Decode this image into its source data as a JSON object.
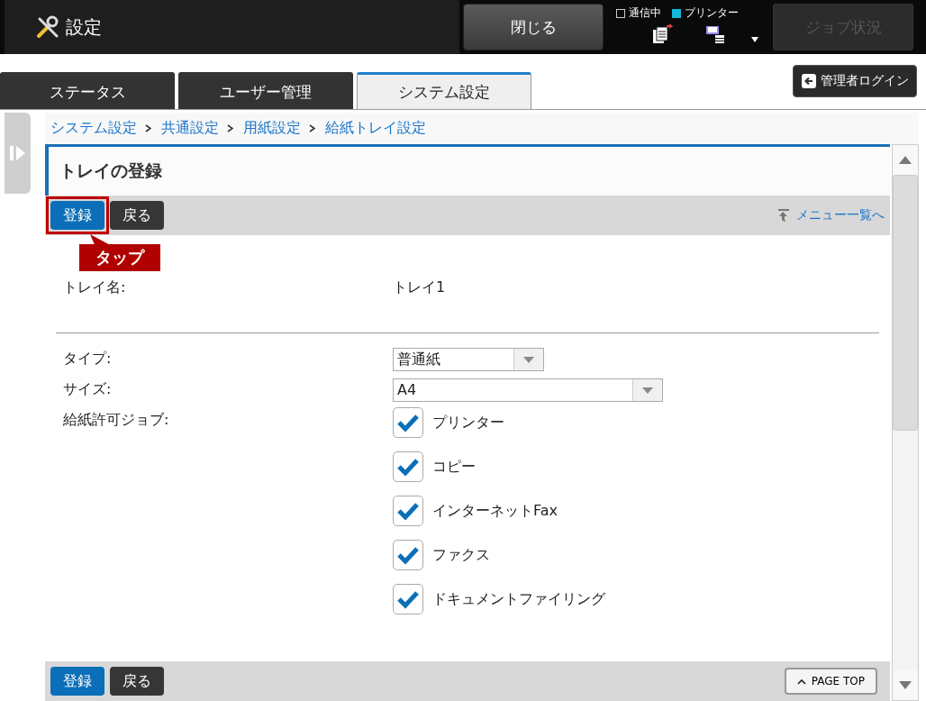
{
  "header": {
    "title": "設定",
    "close_button": "閉じる",
    "indicators": [
      {
        "label": "通信中",
        "on": false
      },
      {
        "label": "プリンター",
        "on": true
      }
    ],
    "job_status_button": {
      "label": "ジョブ状況",
      "disabled": true
    }
  },
  "tabs": [
    {
      "label": "ステータス",
      "selected": false
    },
    {
      "label": "ユーザー管理",
      "selected": false
    },
    {
      "label": "システム設定",
      "selected": true
    }
  ],
  "admin_login": "管理者ログイン",
  "breadcrumb": [
    "システム設定",
    "共通設定",
    "用紙設定",
    "給紙トレイ設定"
  ],
  "page_title": "トレイの登録",
  "toolbar": {
    "buttons": [
      {
        "label": "登録",
        "kind": "primary"
      },
      {
        "label": "戻る",
        "kind": "secondary"
      }
    ],
    "menu_link": "メニュー一覧へ"
  },
  "callout": "タップ",
  "tray_name": {
    "label": "トレイ名:",
    "value": "トレイ1"
  },
  "type": {
    "label": "タイプ:",
    "value": "普通紙"
  },
  "size": {
    "label": "サイズ:",
    "value": "A4"
  },
  "allowed_jobs": {
    "label": "給紙許可ジョブ:",
    "items": [
      {
        "label": "プリンター",
        "checked": true
      },
      {
        "label": "コピー",
        "checked": true
      },
      {
        "label": "インターネットFax",
        "checked": true
      },
      {
        "label": "ファクス",
        "checked": true
      },
      {
        "label": "ドキュメントファイリング",
        "checked": true
      }
    ]
  },
  "bottom_toolbar": {
    "buttons": [
      {
        "label": "登録",
        "kind": "primary"
      },
      {
        "label": "戻る",
        "kind": "secondary"
      }
    ],
    "page_top": "PAGE TOP"
  }
}
